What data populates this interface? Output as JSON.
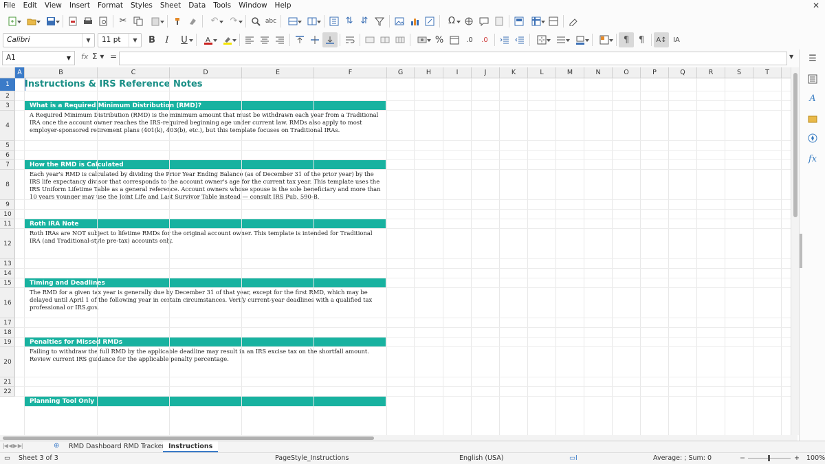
{
  "menu": [
    "File",
    "Edit",
    "View",
    "Insert",
    "Format",
    "Styles",
    "Sheet",
    "Data",
    "Tools",
    "Window",
    "Help"
  ],
  "toolbar": {
    "font_name": "Calibri",
    "font_size": "11 pt"
  },
  "formula_bar": {
    "cell_ref": "A1",
    "content": ""
  },
  "columns": [
    "A",
    "B",
    "C",
    "D",
    "E",
    "F",
    "G",
    "H",
    "I",
    "J",
    "K",
    "L",
    "M",
    "N",
    "O",
    "P",
    "Q",
    "R",
    "S",
    "T"
  ],
  "rows": [
    "1",
    "2",
    "3",
    "4",
    "5",
    "6",
    "7",
    "8",
    "9",
    "10",
    "11",
    "12",
    "13",
    "14",
    "15",
    "16",
    "17",
    "18",
    "19",
    "20",
    "21",
    "22"
  ],
  "doc": {
    "title": "Instructions & IRS Reference Notes",
    "sections": [
      {
        "heading": "What is a Required Minimum Distribution (RMD)?",
        "text": "A Required Minimum Distribution (RMD) is the minimum amount that must be withdrawn each year from a Traditional IRA once the account owner reaches the IRS-required beginning age under current law. RMDs also apply to most employer-sponsored retirement plans (401(k), 403(b), etc.), but this template focuses on Traditional IRAs."
      },
      {
        "heading": "How the RMD is Calculated",
        "text": "Each year's RMD is calculated by dividing the Prior Year Ending Balance (as of December 31 of the prior year) by the IRS life expectancy divisor that corresponds to the account owner's age for the current tax year. This template uses the IRS Uniform Lifetime Table as a general reference. Account owners whose spouse is the sole beneficiary and more than 10 years younger may use the Joint Life and Last Survivor Table instead — consult IRS Pub. 590-B."
      },
      {
        "heading": "Roth IRA Note",
        "text": "Roth IRAs are NOT subject to lifetime RMDs for the original account owner. This template is intended for Traditional IRA (and Traditional-style pre-tax) accounts only."
      },
      {
        "heading": "Timing and Deadlines",
        "text": "The RMD for a given tax year is generally due by December 31 of that year, except for the first RMD, which may be delayed until April 1 of the following year in certain circumstances. Verify current-year deadlines with a qualified tax professional or IRS.gov."
      },
      {
        "heading": "Penalties for Missed RMDs",
        "text": "Failing to withdraw the full RMD by the applicable deadline may result in an IRS excise tax on the shortfall amount. Review current IRS guidance for the applicable penalty percentage."
      },
      {
        "heading": "Planning Tool Only",
        "text": ""
      }
    ]
  },
  "tabs": {
    "items": [
      "RMD Dashboard",
      "RMD Tracker",
      "Instructions"
    ],
    "active": 2
  },
  "status": {
    "sheet": "Sheet 3 of 3",
    "page_style": "PageStyle_Instructions",
    "language": "English (USA)",
    "summary": "Average: ; Sum: 0",
    "zoom": "100%"
  }
}
